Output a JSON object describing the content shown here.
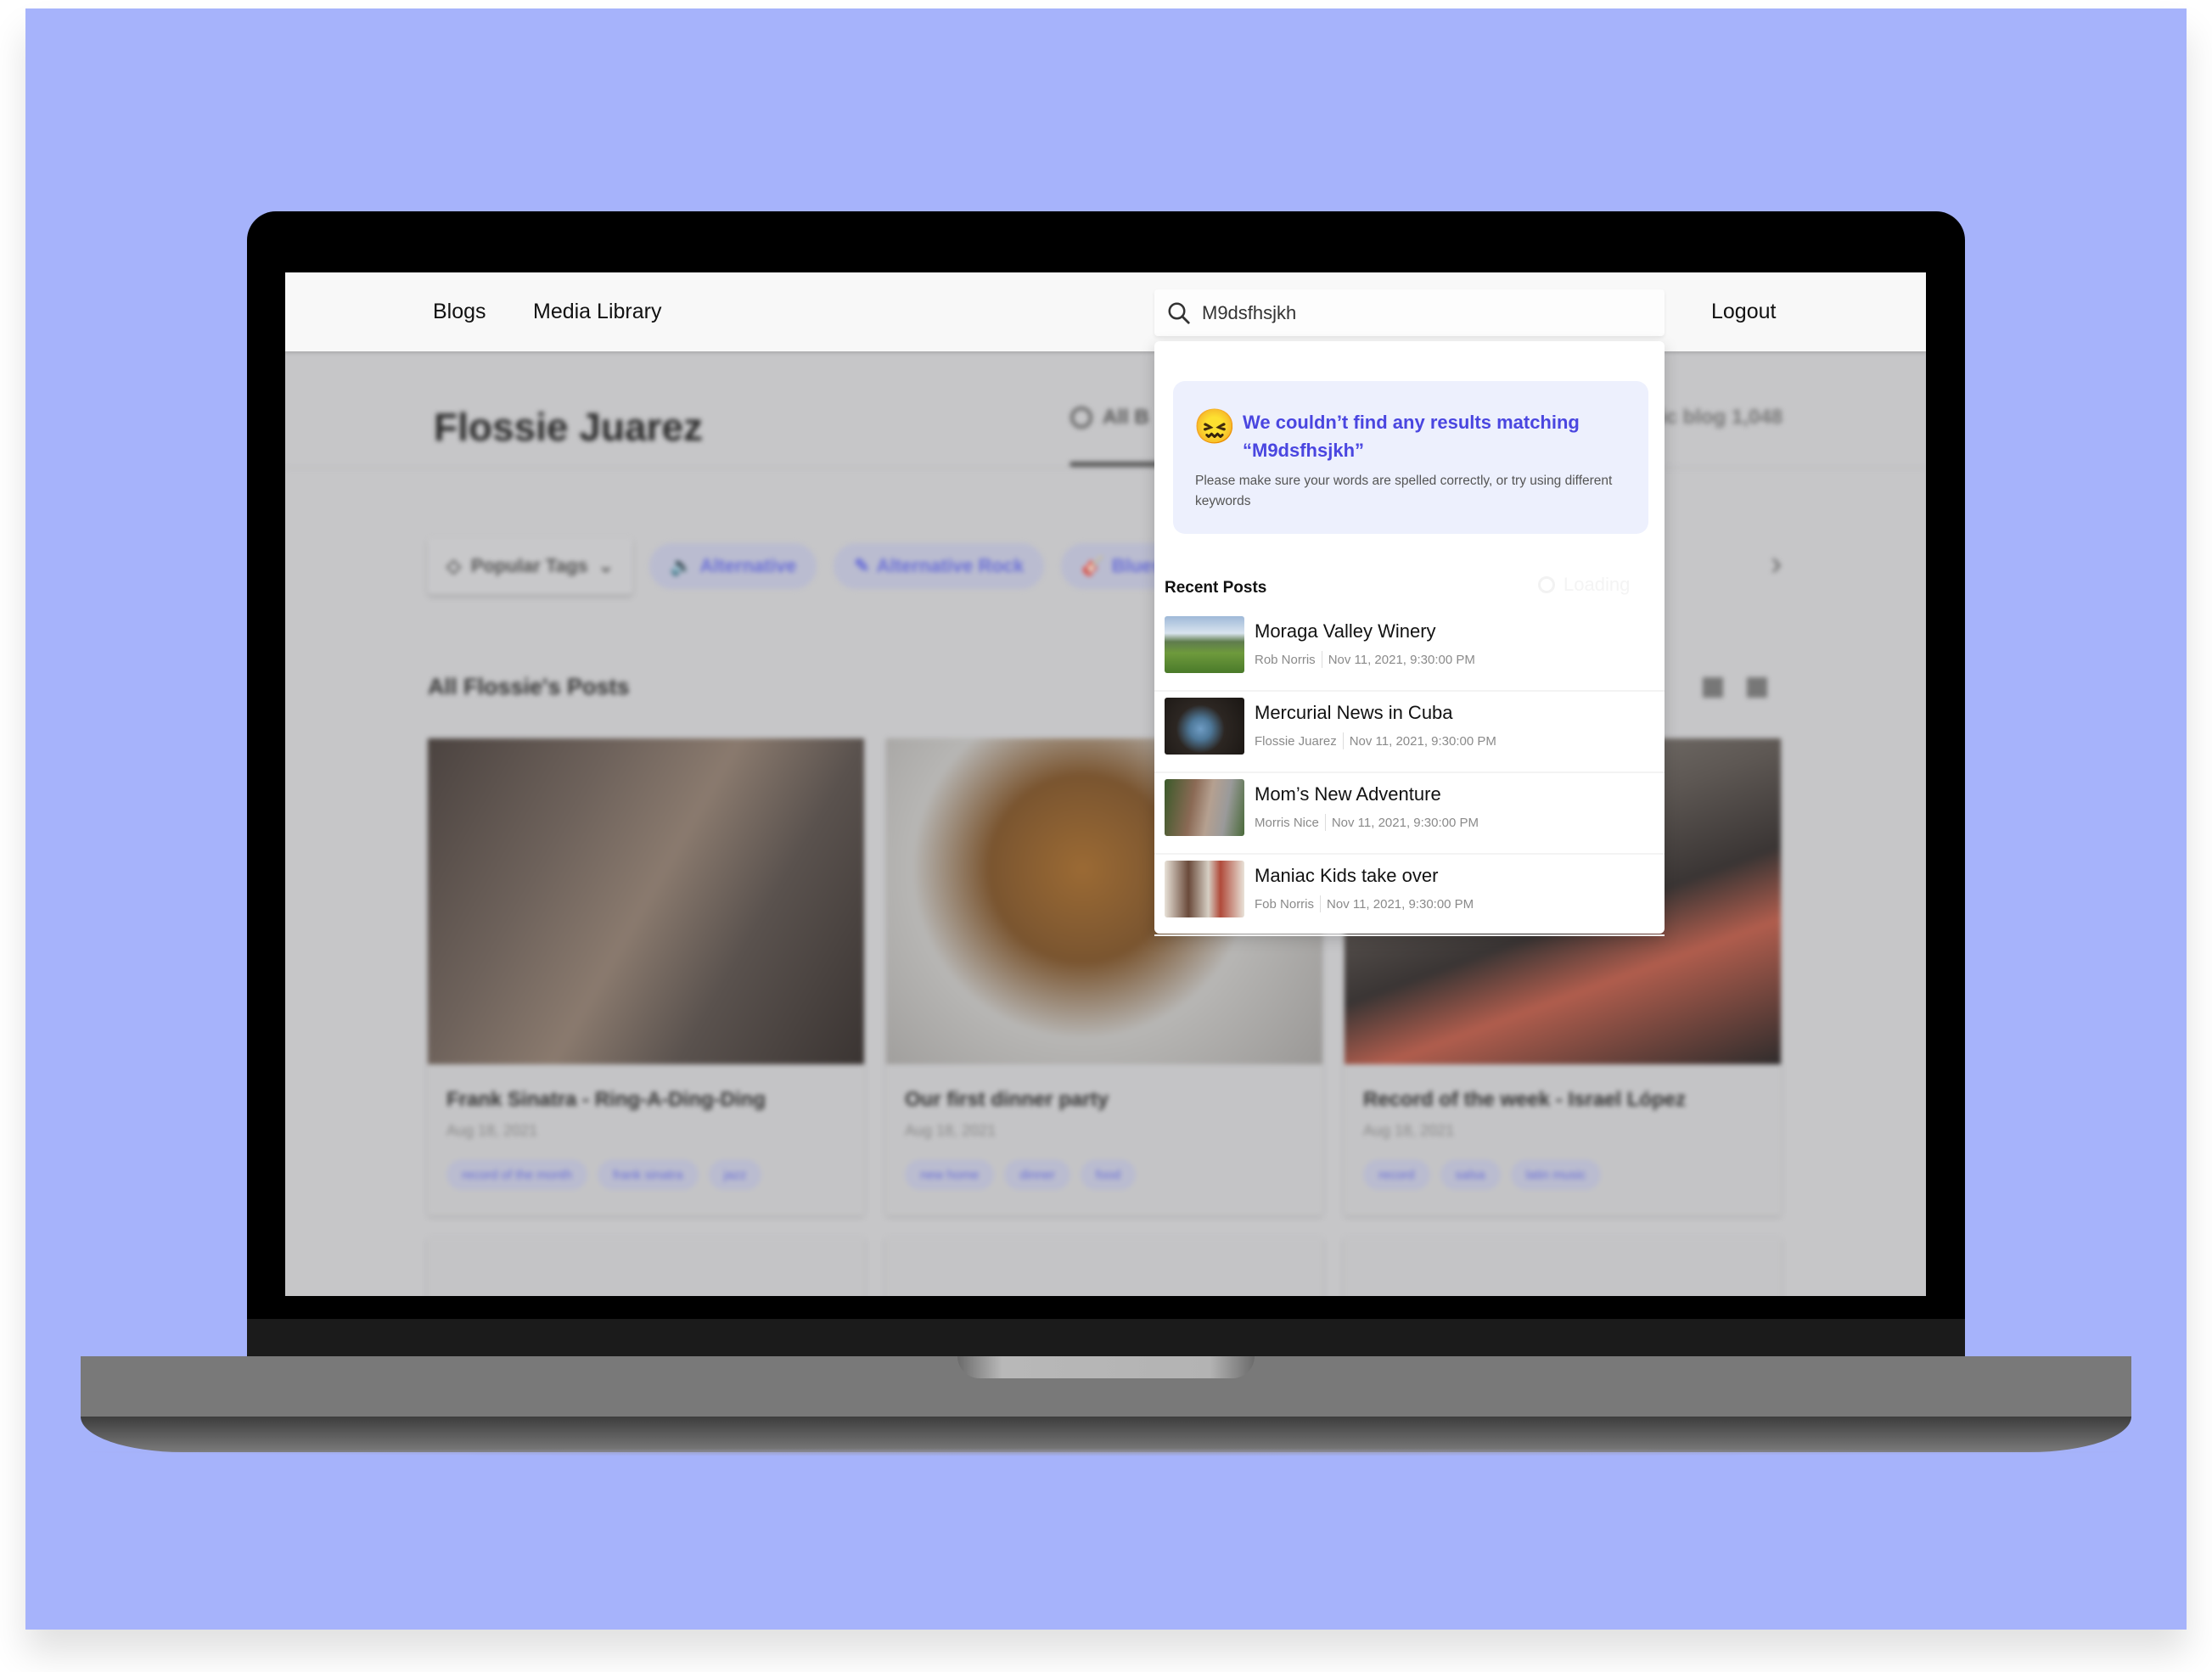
{
  "nav": {
    "blogs": "Blogs",
    "media_library": "Media Library",
    "logout": "Logout"
  },
  "search": {
    "value": "M9dsfhsjkh",
    "icon": "search-icon"
  },
  "no_results": {
    "emoji": "😖",
    "title": "We couldn’t find any results matching “M9dsfhsjkh”",
    "subtitle": "Please make sure your words are spelled correctly, or try using different keywords"
  },
  "recent": {
    "label": "Recent Posts",
    "loading": "Loading",
    "items": [
      {
        "title": "Moraga Valley Winery",
        "author": "Rob Norris",
        "date": "Nov 11, 2021, 9:30:00 PM"
      },
      {
        "title": "Mercurial News in Cuba",
        "author": "Flossie Juarez",
        "date": "Nov 11, 2021, 9:30:00 PM"
      },
      {
        "title": "Mom’s New Adventure",
        "author": "Morris Nice",
        "date": "Nov 11, 2021, 9:30:00 PM"
      },
      {
        "title": "Maniac Kids take over",
        "author": "Fob Norris",
        "date": "Nov 11, 2021, 9:30:00 PM"
      }
    ]
  },
  "background": {
    "author_name": "Flossie Juarez",
    "tab_all": "All B",
    "blog_count": "ic blog 1,048",
    "popular_tags": "Popular Tags",
    "tags": [
      "Alternative",
      "Alternative Rock",
      "Blues"
    ],
    "posts_heading": "All Flossie's Posts",
    "cards": [
      {
        "title": "Frank Sinatra - Ring-A-Ding-Ding",
        "date": "Aug 18, 2021",
        "tags": [
          "record of the month",
          "frank sinatra",
          "jazz"
        ]
      },
      {
        "title": "Our first dinner party",
        "date": "Aug 18, 2021",
        "tags": [
          "new home",
          "dinner",
          "food"
        ]
      },
      {
        "title": "Record of the week - Israel López",
        "date": "Aug 18, 2021",
        "tags": [
          "record",
          "salsa",
          "latin music"
        ]
      }
    ]
  },
  "colors": {
    "backdrop": "#a6b3fb",
    "accent": "#4a46e0",
    "no_results_bg": "#edf0fd"
  }
}
